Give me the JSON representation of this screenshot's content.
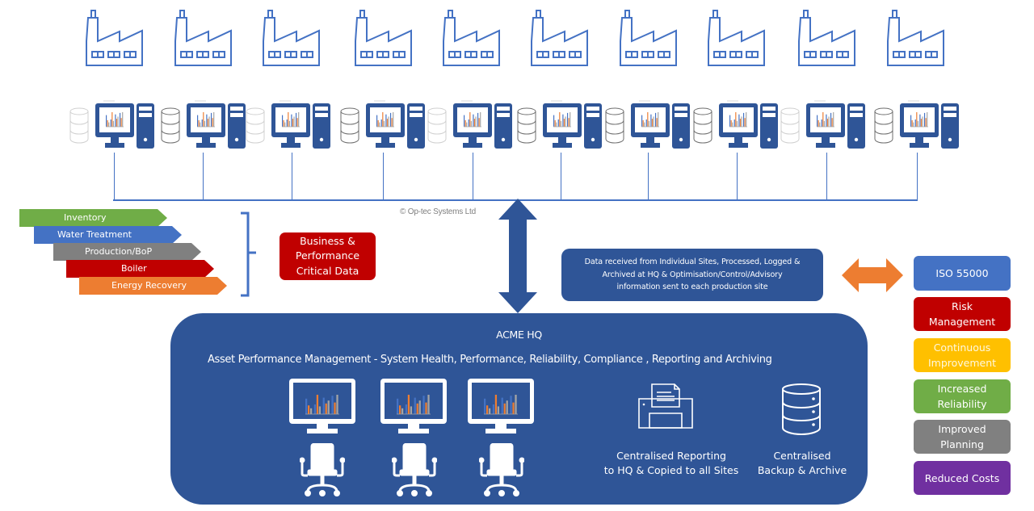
{
  "diagram": {
    "copyright": "© Op-tec Systems  Ltd",
    "site_count": 10,
    "site_icon": "factory-icon",
    "workstation_icon": "desktop-computer-icon",
    "server_icon": "database-icon",
    "categories": [
      {
        "label": "Inventory",
        "color": "#70ad47"
      },
      {
        "label": "Water Treatment",
        "color": "#4472c4"
      },
      {
        "label": "Production/BoP",
        "color": "#808080"
      },
      {
        "label": "Boiler",
        "color": "#c00000"
      },
      {
        "label": "Energy Recovery",
        "color": "#ed7d31"
      }
    ],
    "critical_data": {
      "lines": [
        "Business &",
        "Performance",
        "Critical Data"
      ],
      "color": "#c00000"
    },
    "data_flow": {
      "lines": [
        "Data received  from Individual Sites, Processed, Logged &",
        "Archived at HQ & Optimisation/Control/Advisory",
        "information sent to each production site"
      ],
      "color": "#2f5597"
    },
    "hq": {
      "title": "ACME HQ",
      "subtitle": "Asset Performance Management - System Health, Performance, Reliability, Compliance , Reporting and Archiving",
      "reporting": [
        "Centralised Reporting",
        "to HQ & Copied to all Sites"
      ],
      "backup": [
        "Centralised",
        "Backup & Archive"
      ],
      "color": "#2f5597"
    },
    "benefits": [
      {
        "lines": [
          "ISO 55000"
        ],
        "color": "#4472c4"
      },
      {
        "lines": [
          "Risk",
          "Management"
        ],
        "color": "#c00000"
      },
      {
        "lines": [
          "Continuous",
          "Improvement"
        ],
        "color": "#ffc000"
      },
      {
        "lines": [
          "Increased",
          "Reliability"
        ],
        "color": "#70ad47"
      },
      {
        "lines": [
          "Improved",
          "Planning"
        ],
        "color": "#808080"
      },
      {
        "lines": [
          "Reduced Costs"
        ],
        "color": "#7030a0"
      }
    ],
    "colors": {
      "primary": "#2f5597",
      "line": "#4472c4",
      "accent": "#ed7d31"
    }
  }
}
